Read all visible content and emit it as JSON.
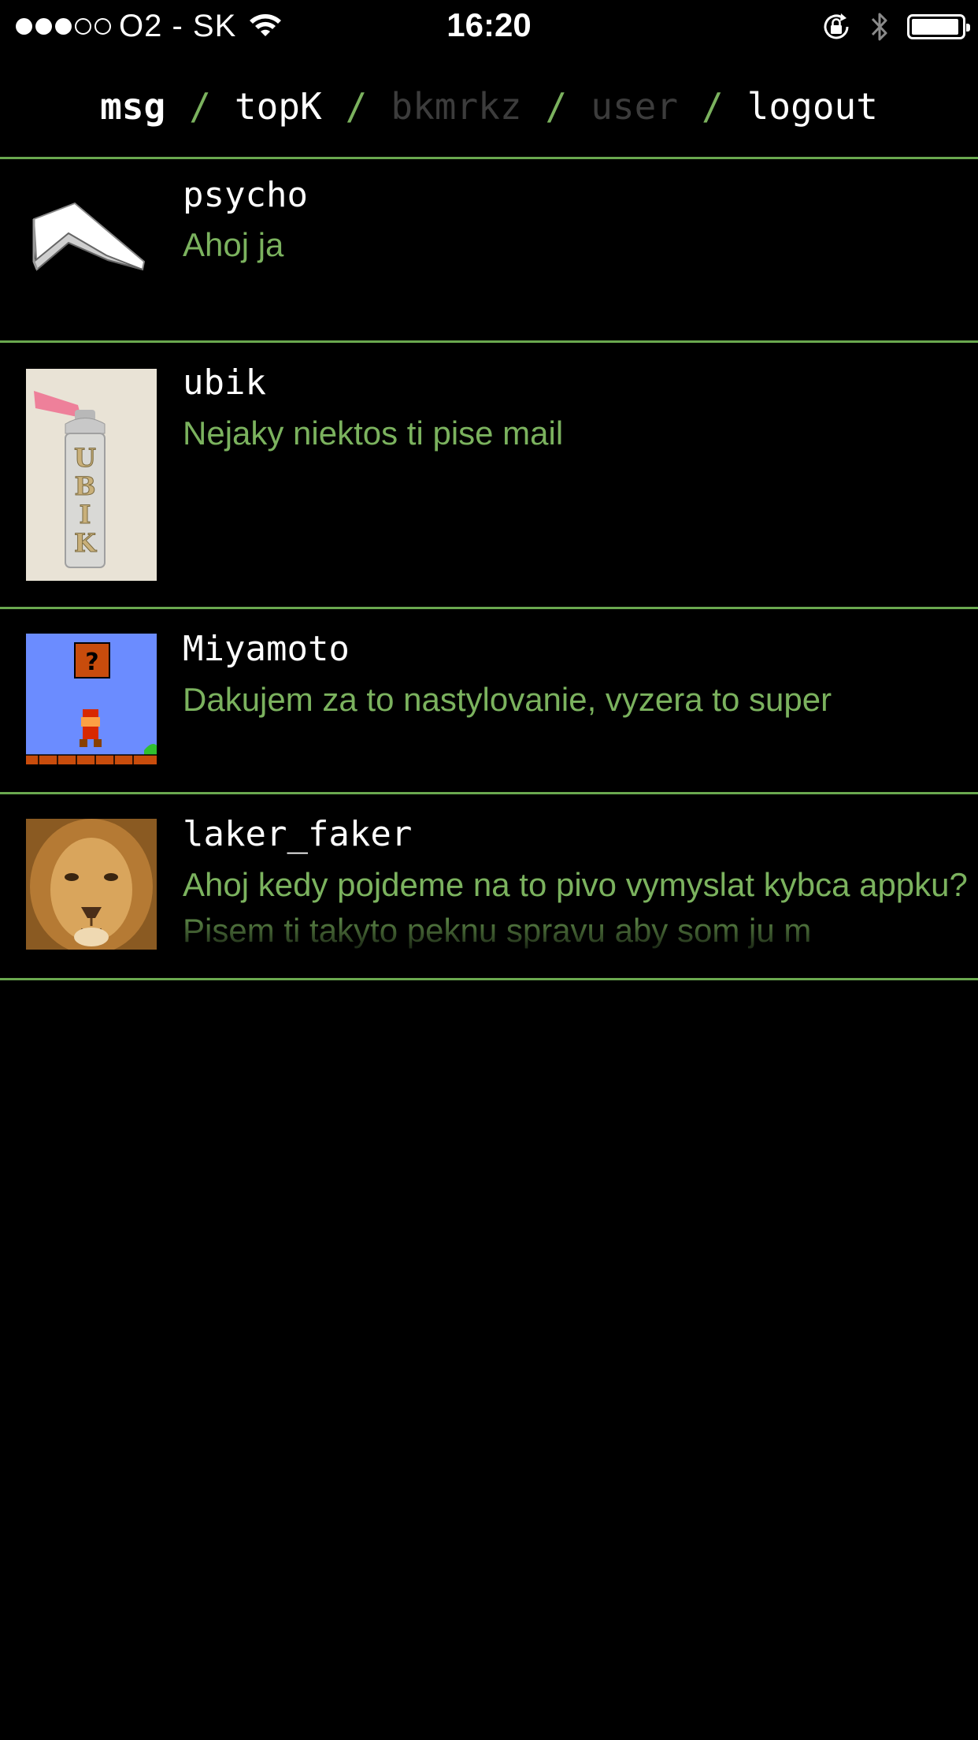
{
  "status_bar": {
    "signal": {
      "filled": 3,
      "total": 5
    },
    "carrier": "O2 - SK",
    "time": "16:20",
    "battery_level": 0.95,
    "icons": [
      "wifi-icon",
      "rotation-lock-icon",
      "bluetooth-icon",
      "battery-icon"
    ]
  },
  "nav": {
    "items": [
      {
        "label": "msg",
        "state": "active"
      },
      {
        "label": "topK",
        "state": "normal"
      },
      {
        "label": "bkmrkz",
        "state": "dim"
      },
      {
        "label": "user",
        "state": "dim"
      },
      {
        "label": "logout",
        "state": "normal"
      }
    ],
    "separator": "/"
  },
  "messages": [
    {
      "user": "psycho",
      "text": "Ahoj ja",
      "avatar": "book-avatar"
    },
    {
      "user": "ubik",
      "text": "Nejaky niektos ti pise mail",
      "avatar": "ubik-spray-can-avatar"
    },
    {
      "user": "Miyamoto",
      "text": "Dakujem za to nastylovanie, vyzera to super",
      "avatar": "mario-avatar"
    },
    {
      "user": "laker_faker",
      "text": "Ahoj kedy pojdeme na to pivo vymyslat kybca appku? Pisem ti takyto peknu spravu aby som ju m",
      "avatar": "lion-avatar"
    }
  ],
  "colors": {
    "accent": "#6aa84f",
    "message_text": "#7bb25e",
    "background": "#000000",
    "dim_nav": "#3c3c3c"
  }
}
